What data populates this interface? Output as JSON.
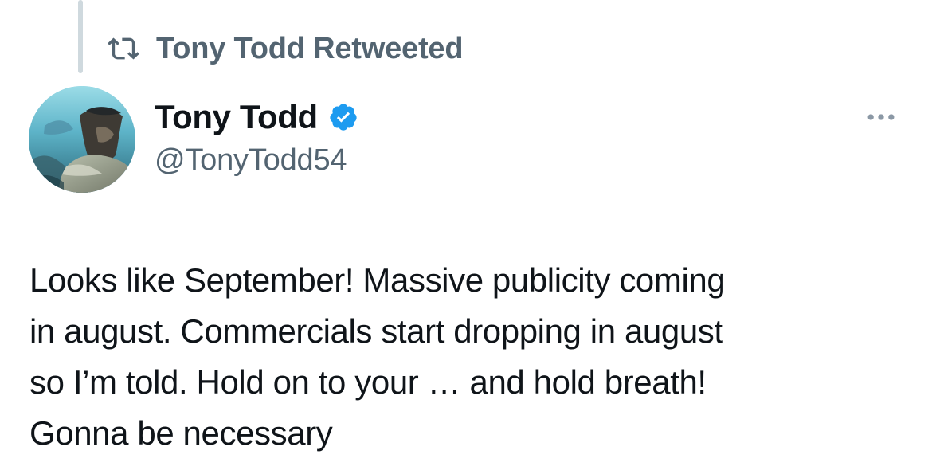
{
  "retweet": {
    "icon": "retweet-icon",
    "label": "Tony Todd Retweeted"
  },
  "author": {
    "name": "Tony Todd",
    "handle": "@TonyTodd54",
    "verified_icon": "verified-badge-icon",
    "verified_color": "#1d9bf0"
  },
  "tweet": {
    "text": "Looks like September! Massive publicity coming\nin august. Commercials start dropping in august\nso I’m told. Hold on to your … and hold breath!\nGonna be necessary"
  },
  "menu": {
    "icon": "more-horizontal-icon"
  },
  "colors": {
    "primary_text": "#0f1419",
    "secondary_text": "#536471",
    "thread_line": "#cfd9de",
    "background": "#ffffff"
  }
}
